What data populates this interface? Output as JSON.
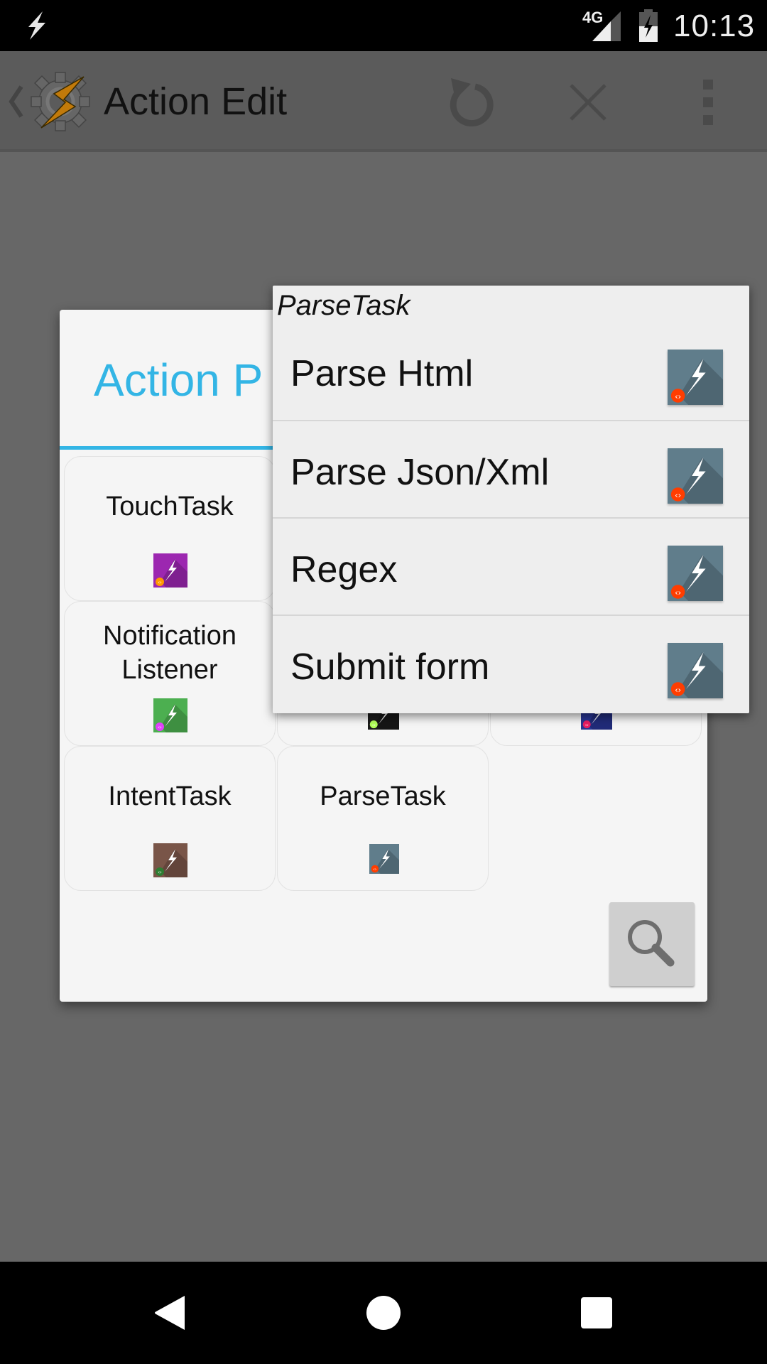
{
  "status_bar": {
    "network_type": "4G",
    "time": "10:13",
    "icons": [
      "tasker-bolt-icon",
      "signal-icon",
      "battery-charging-icon"
    ]
  },
  "toolbar": {
    "title": "Action Edit",
    "actions": [
      "undo-icon",
      "close-icon",
      "overflow-menu-icon"
    ]
  },
  "dialog": {
    "title": "Action P",
    "accent_color": "#33b5e5",
    "cells": [
      {
        "label": "TouchTask",
        "icon_color": "#9c27b0",
        "badge_color": "#ff9800",
        "visible": true
      },
      {
        "label": "Notification Listener",
        "icon_color": "#4caf50",
        "badge_color": "#e040fb",
        "visible": true
      },
      {
        "label": "",
        "icon_color": "#1a1a1a",
        "badge_color": "#b2ff59",
        "visible": "partial"
      },
      {
        "label": "",
        "icon_color": "#283593",
        "badge_color": "#e91e63",
        "visible": "partial"
      },
      {
        "label": "IntentTask",
        "icon_color": "#795548",
        "badge_color": "#2e7d32",
        "visible": true
      },
      {
        "label": "ParseTask",
        "icon_color": "#607d8b",
        "badge_color": "#ff3d00",
        "visible": true
      }
    ],
    "search_button": "search-icon"
  },
  "popup": {
    "title": "ParseTask",
    "icon_color": "#607d8b",
    "badge_color": "#ff3d00",
    "items": [
      {
        "label": "Parse Html"
      },
      {
        "label": "Parse Json/Xml"
      },
      {
        "label": "Regex"
      },
      {
        "label": "Submit form"
      }
    ]
  },
  "nav_bar": {
    "buttons": [
      "back-icon",
      "home-icon",
      "recents-icon"
    ]
  }
}
